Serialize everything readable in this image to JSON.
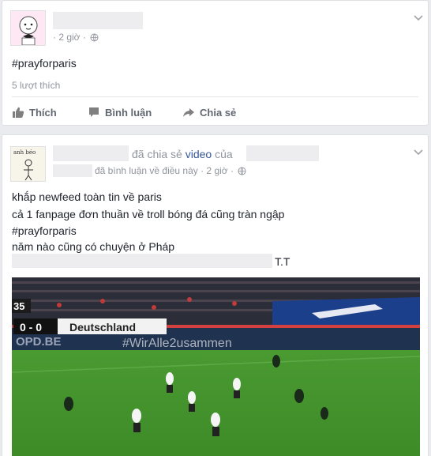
{
  "post1": {
    "timestamp": "· 2 giờ ·",
    "text": "#prayforparis",
    "likes": "5 lượt thích",
    "actions": {
      "like": "Thích",
      "comment": "Bình luận",
      "share": "Chia sẻ"
    }
  },
  "post2": {
    "avatar_caption": "anh béo",
    "shared_text": "đã chia sẻ",
    "video_link": "video",
    "of_text": "của",
    "commented_text": "đã bình luận về điều này · 2 giờ ·",
    "lines": [
      "khắp newfeed toàn tin về paris",
      "cả 1 fanpage đơn thuần về troll bóng đá cũng tràn ngập",
      "#prayforparis",
      "năm nào cũng có chuyện ở Pháp"
    ],
    "line5_tail": "T.T",
    "video": {
      "minute": "35",
      "score": "0 - 0",
      "team": "Deutschland",
      "board_left": "OPD.BE",
      "board_right": "#WirAlle2usammen"
    }
  },
  "colors": {
    "link": "#365899",
    "meta": "#90949c",
    "action": "#616770",
    "pitch": "#3e8a2a"
  }
}
